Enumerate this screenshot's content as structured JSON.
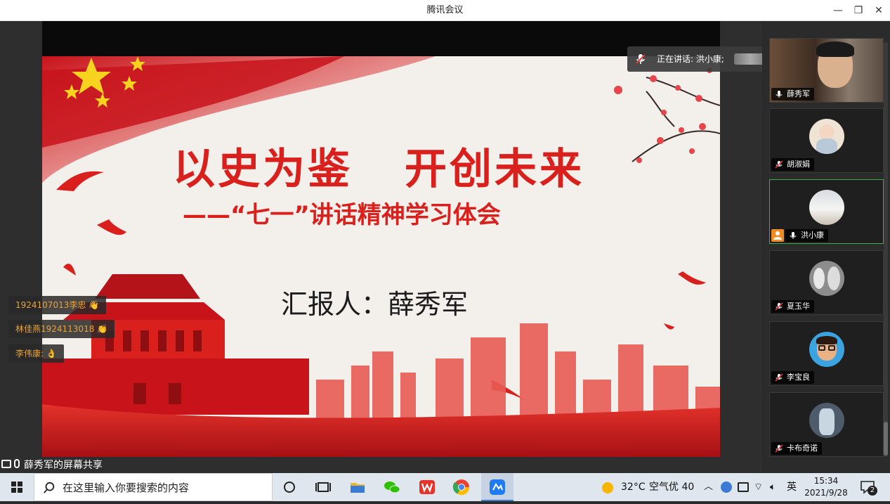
{
  "window": {
    "title": "腾讯会议",
    "minimize": "—",
    "restore": "❐",
    "close": "✕"
  },
  "speaking_banner": {
    "text": "正在讲话: 洪小康;",
    "icon": "mic-muted-icon",
    "back_icon": "return-icon"
  },
  "slide": {
    "title_left": "以史为鉴",
    "title_right": "开创未来",
    "subtitle": "——“七一”讲话精神学习体会",
    "reporter": "汇报人：薛秀军",
    "colors": {
      "red": "#d9201c",
      "dark_red": "#b5131a",
      "bg": "#f3efeb"
    }
  },
  "reactions": [
    {
      "text": "1924107013李忠",
      "emoji": "👋"
    },
    {
      "text": "林佳燕1924113018",
      "emoji": "👏"
    },
    {
      "text": "李伟康:",
      "emoji": "👌"
    }
  ],
  "share_bar": {
    "label": "薛秀军的屏幕共享"
  },
  "participants": [
    {
      "name": "薛秀军",
      "mic": "on",
      "video": true
    },
    {
      "name": "胡淑娟",
      "mic": "muted"
    },
    {
      "name": "洪小康",
      "mic": "on",
      "host": true,
      "active": true
    },
    {
      "name": "夏玉华",
      "mic": "muted"
    },
    {
      "name": "李宝良",
      "mic": "muted"
    },
    {
      "name": "卡布奇诺",
      "mic": "muted"
    }
  ],
  "taskbar": {
    "search_placeholder": "在这里输入你要搜索的内容",
    "weather": "32°C",
    "air": "空气优 40",
    "ime": "英",
    "time": "15:34",
    "date": "2021/9/28",
    "notifications": "2"
  }
}
